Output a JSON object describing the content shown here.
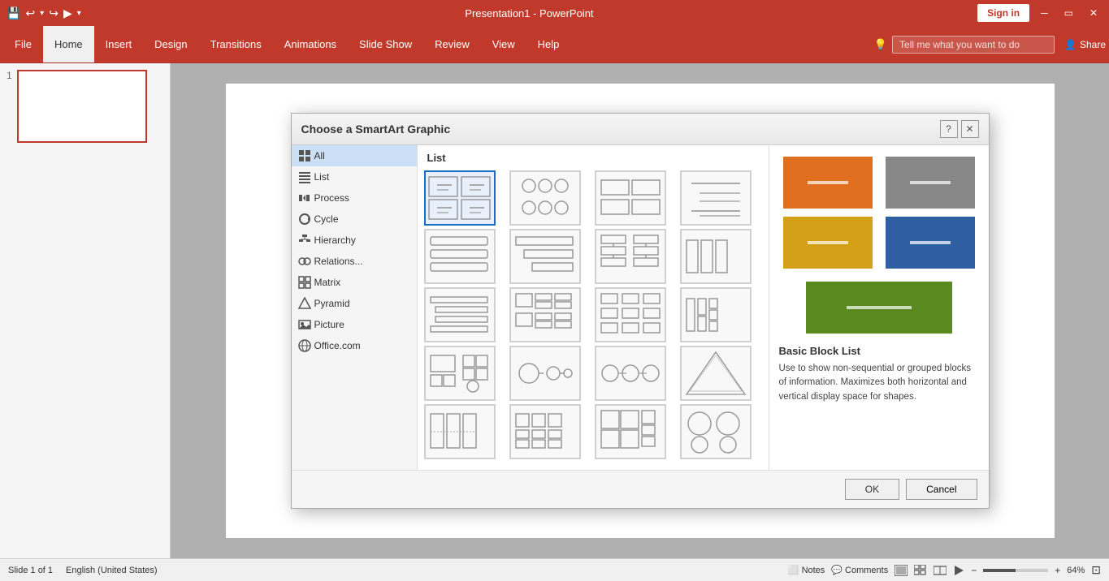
{
  "titleBar": {
    "title": "Presentation1 - PowerPoint",
    "signInLabel": "Sign in",
    "shareLabel": "Share"
  },
  "ribbon": {
    "tabs": [
      "File",
      "Home",
      "Insert",
      "Design",
      "Transitions",
      "Animations",
      "Slide Show",
      "Review",
      "View",
      "Help"
    ],
    "activeTab": "Home",
    "searchPlaceholder": "Tell me what you want to do",
    "lightbulbIcon": "💡"
  },
  "slidePanel": {
    "slideNumber": "1"
  },
  "statusBar": {
    "slideInfo": "Slide 1 of 1",
    "language": "English (United States)",
    "notesLabel": "Notes",
    "commentsLabel": "Comments",
    "zoomLevel": "64%"
  },
  "dialog": {
    "title": "Choose a SmartArt Graphic",
    "categories": [
      {
        "id": "all",
        "label": "All",
        "icon": "grid"
      },
      {
        "id": "list",
        "label": "List",
        "icon": "list"
      },
      {
        "id": "process",
        "label": "Process",
        "icon": "process"
      },
      {
        "id": "cycle",
        "label": "Cycle",
        "icon": "cycle"
      },
      {
        "id": "hierarchy",
        "label": "Hierarchy",
        "icon": "hierarchy"
      },
      {
        "id": "relationship",
        "label": "Relations...",
        "icon": "relationship"
      },
      {
        "id": "matrix",
        "label": "Matrix",
        "icon": "matrix"
      },
      {
        "id": "pyramid",
        "label": "Pyramid",
        "icon": "pyramid"
      },
      {
        "id": "picture",
        "label": "Picture",
        "icon": "picture"
      },
      {
        "id": "office",
        "label": "Office.com",
        "icon": "office"
      }
    ],
    "selectedCategory": "all",
    "panelTitle": "List",
    "selectedGraphic": 0,
    "previewTitle": "Basic Block List",
    "previewDesc": "Use to show non-sequential or grouped blocks of information. Maximizes both horizontal and vertical display space for shapes.",
    "okLabel": "OK",
    "cancelLabel": "Cancel"
  }
}
